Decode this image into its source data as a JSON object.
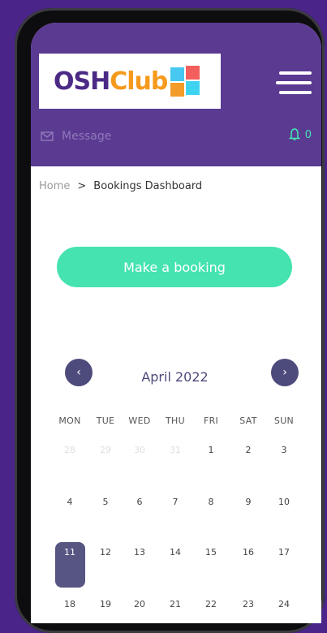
{
  "logo": {
    "part1": "OSH",
    "part2": "Club"
  },
  "header": {
    "message_label": "Message",
    "notification_count": "0"
  },
  "breadcrumb": {
    "home": "Home",
    "separator": ">",
    "current": "Bookings Dashboard"
  },
  "booking_button": "Make a booking",
  "calendar": {
    "month_label": "April 2022",
    "prev_symbol": "‹",
    "next_symbol": "›",
    "weekdays": [
      "MON",
      "TUE",
      "WED",
      "THU",
      "FRI",
      "SAT",
      "SUN"
    ],
    "weeks": [
      [
        "28",
        "29",
        "30",
        "31",
        "1",
        "2",
        "3"
      ],
      [
        "4",
        "5",
        "6",
        "7",
        "8",
        "9",
        "10"
      ],
      [
        "11",
        "12",
        "13",
        "14",
        "15",
        "16",
        "17"
      ],
      [
        "18",
        "19",
        "20",
        "21",
        "22",
        "23",
        "24"
      ]
    ],
    "muted_days_first_week": 4,
    "selected_day": "11"
  },
  "colors": {
    "background": "#4a2488",
    "header": "#5b3a92",
    "accent_green": "#45e3b0",
    "calendar_dark": "#4d4a7c"
  }
}
